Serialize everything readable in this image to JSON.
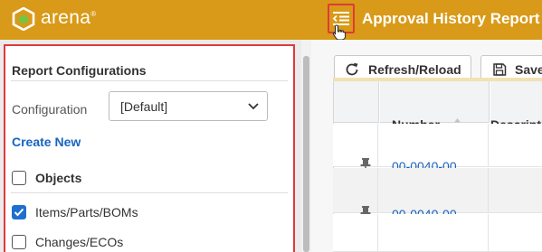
{
  "app": {
    "logo_text": "arena",
    "logo_mark": "®",
    "logo_icon": "arena-hexagon-logo-icon",
    "report_title": "Approval History Report",
    "toggle_icon": "collapse-panel-icon",
    "brand_color": "#d89a18",
    "highlight_color": "#e03a3a",
    "link_color": "#1764c0"
  },
  "panel": {
    "heading": "Report Configurations",
    "configuration_label": "Configuration",
    "configuration_value": "[Default]",
    "create_new": "Create New",
    "objects_label": "Objects",
    "objects_checked": false,
    "items": [
      {
        "label": "Items/Parts/BOMs",
        "checked": true
      },
      {
        "label": "Changes/ECOs",
        "checked": false
      }
    ]
  },
  "toolbar": {
    "refresh_label": "Refresh/Reload",
    "refresh_icon": "refresh-icon",
    "save_label": "Save",
    "save_icon": "save-icon"
  },
  "grid": {
    "columns": [
      "Number",
      "Descriptio"
    ],
    "rows": [
      {
        "number": "00-0040-00"
      },
      {
        "number": "00-0040-00"
      }
    ]
  }
}
